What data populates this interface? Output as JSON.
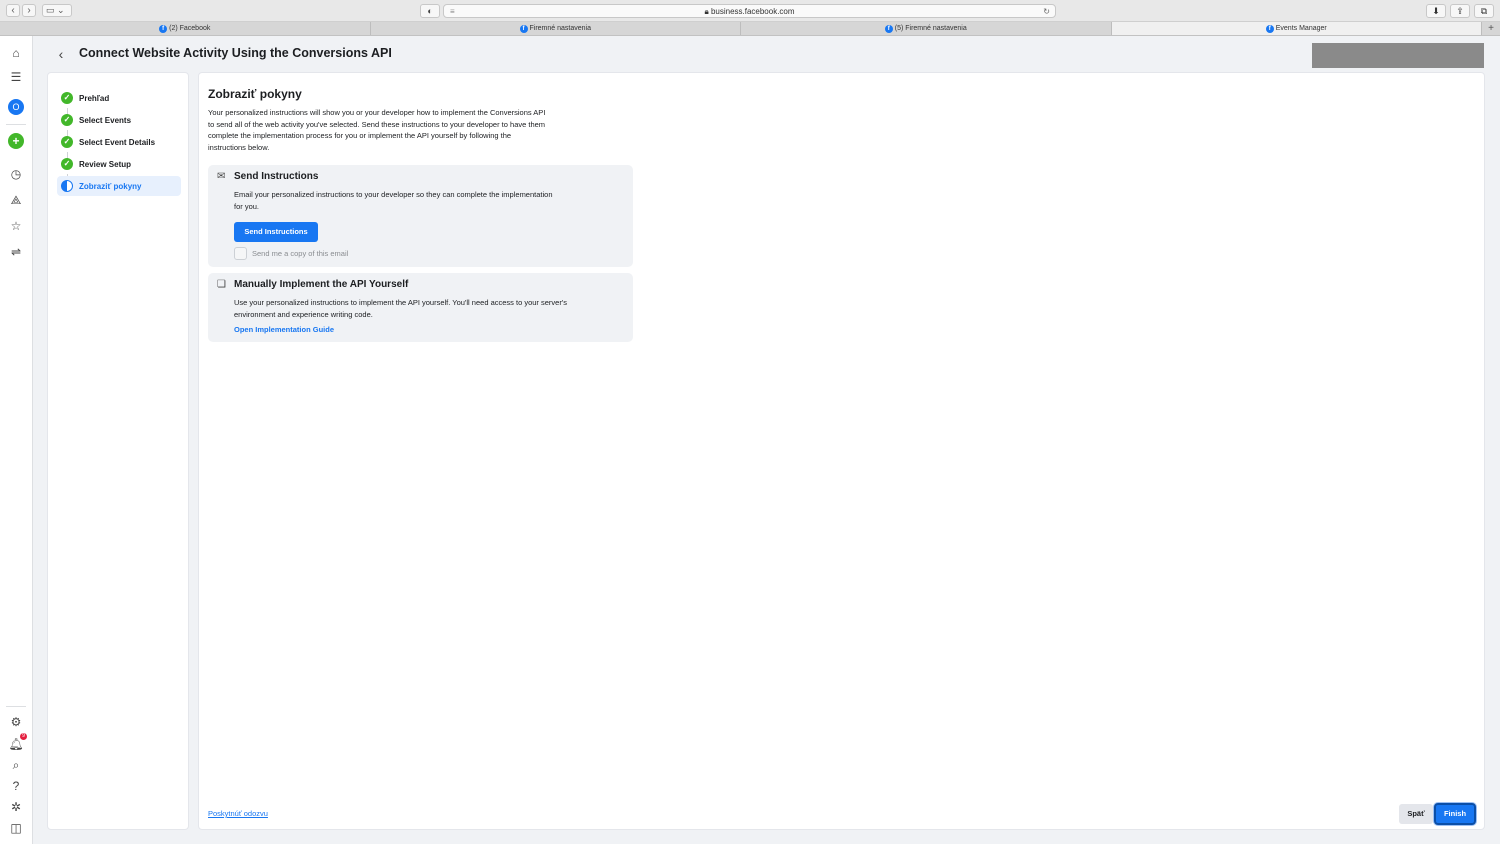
{
  "browser": {
    "url": "business.facebook.com",
    "tabs": [
      {
        "label": "(2) Facebook"
      },
      {
        "label": "Firemné nastavenia"
      },
      {
        "label": "(5) Firemné nastavenia"
      },
      {
        "label": "Events Manager"
      }
    ],
    "new_tab": "+"
  },
  "header": {
    "title": "Connect Website Activity Using the Conversions API",
    "back_icon": "chevron-left-icon"
  },
  "steps": [
    {
      "label": "Prehľad",
      "status": "complete"
    },
    {
      "label": "Select Events",
      "status": "complete"
    },
    {
      "label": "Select Event Details",
      "status": "complete"
    },
    {
      "label": "Review Setup",
      "status": "complete"
    },
    {
      "label": "Zobraziť pokyny",
      "status": "current"
    }
  ],
  "main": {
    "title": "Zobraziť pokyny",
    "intro": "Your personalized instructions will show you or your developer how to implement the Conversions API to send all of the web activity you've selected. Send these instructions to your developer to have them complete the implementation process for you or implement the API yourself by following the instructions below.",
    "send_card": {
      "icon": "envelope-icon",
      "title": "Send Instructions",
      "text": "Email your personalized instructions to your developer so they can complete the implementation for you.",
      "button": "Send Instructions",
      "checkbox_label": "Send me a copy of this email",
      "checkbox_checked": false
    },
    "manual_card": {
      "icon": "document-icon",
      "title": "Manually Implement the API Yourself",
      "text": "Use your personalized instructions to implement the API yourself. You'll need access to your server's environment and experience writing code.",
      "link": "Open Implementation Guide"
    },
    "feedback": "Poskytnúť odozvu",
    "back_button": "Späť",
    "finish_button": "Finish"
  },
  "rail": {
    "notification_count": "9"
  },
  "colors": {
    "accent": "#1877f2",
    "success": "#42b72a",
    "background": "#f0f2f5"
  }
}
